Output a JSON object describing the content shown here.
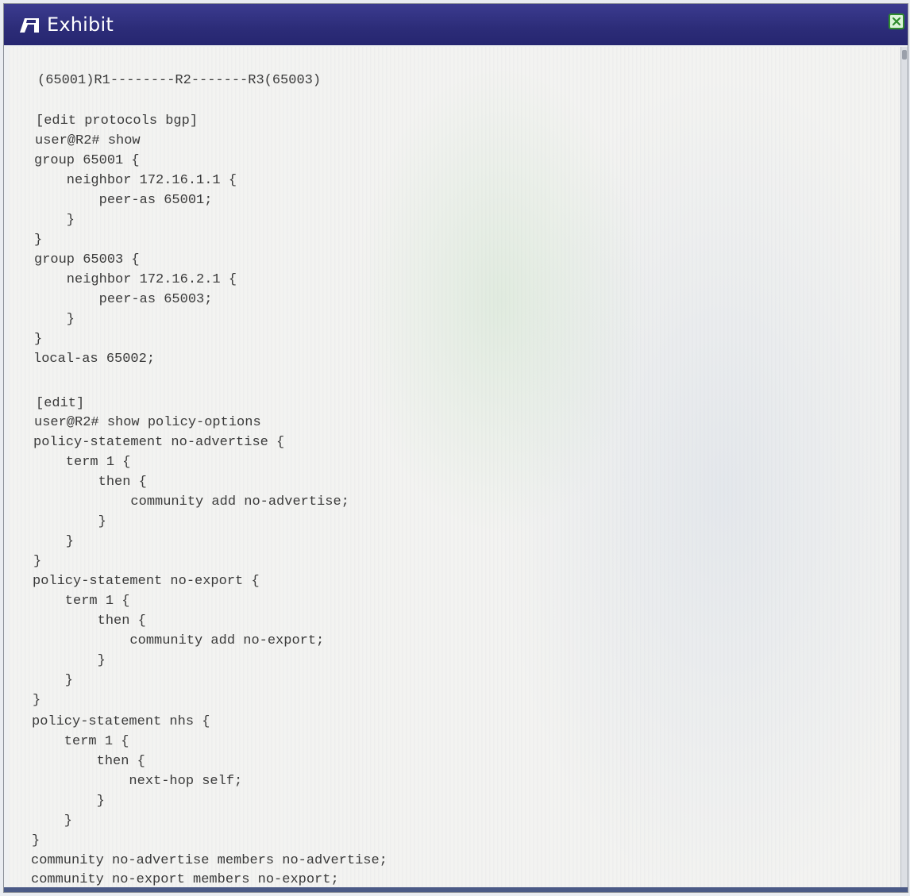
{
  "window": {
    "title": "Exhibit",
    "title_icon": "exhibit-icon",
    "close_icon": "close-icon",
    "accent_color": "#2c2c78"
  },
  "exhibit": {
    "lines": [
      "(65001)R1--------R2-------R3(65003)",
      "[edit protocols bgp]",
      "user@R2# show",
      "group 65001 {",
      "    neighbor 172.16.1.1 {",
      "        peer-as 65001;",
      "    }",
      "}",
      "group 65003 {",
      "    neighbor 172.16.2.1 {",
      "        peer-as 65003;",
      "    }",
      "}",
      "local-as 65002;",
      "[edit]",
      "user@R2# show policy-options",
      "policy-statement no-advertise {",
      "    term 1 {",
      "        then {",
      "            community add no-advertise;",
      "        }",
      "    }",
      "}",
      "policy-statement no-export {",
      "    term 1 {",
      "        then {",
      "            community add no-export;",
      "        }",
      "    }",
      "}",
      "policy-statement nhs {",
      "    term 1 {",
      "        then {",
      "            next-hop self;",
      "        }",
      "    }",
      "}",
      "community no-advertise members no-advertise;",
      "community no-export members no-export;"
    ]
  }
}
